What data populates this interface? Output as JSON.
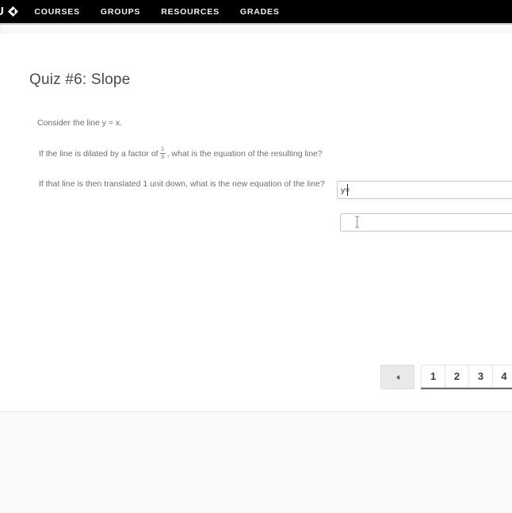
{
  "nav": {
    "brand_text": "U",
    "brand_mark_icon": "diamond-arrow-icon",
    "items": [
      {
        "label": "COURSES"
      },
      {
        "label": "GROUPS"
      },
      {
        "label": "RESOURCES"
      },
      {
        "label": "GRADES"
      }
    ]
  },
  "page": {
    "title": "Quiz #6: Slope"
  },
  "quiz": {
    "intro": "Consider the line y = x.",
    "questions": [
      {
        "text_before": "If the line is dilated by a factor of",
        "fraction": {
          "numerator": "1",
          "denominator": "3"
        },
        "text_after": ", what is the equation of the resulting line?",
        "answer_value": "y=",
        "answer_placeholder": ""
      },
      {
        "text_before": "If that line is then translated 1 unit down, what is the new equation of the line?",
        "fraction": null,
        "text_after": "",
        "answer_value": "",
        "answer_placeholder": ""
      }
    ]
  },
  "pagination": {
    "prev_icon": "triangle-left-icon",
    "prev_label": "",
    "pages": [
      {
        "label": "1"
      },
      {
        "label": "2"
      },
      {
        "label": "3"
      },
      {
        "label": "4"
      }
    ]
  },
  "colors": {
    "nav_background": "#000000",
    "page_background": "#ffffff",
    "band_background": "#faf9f7",
    "input_border": "#b9ccd8",
    "title_text": "#4a4a4a",
    "body_text": "#6e6e6e"
  }
}
